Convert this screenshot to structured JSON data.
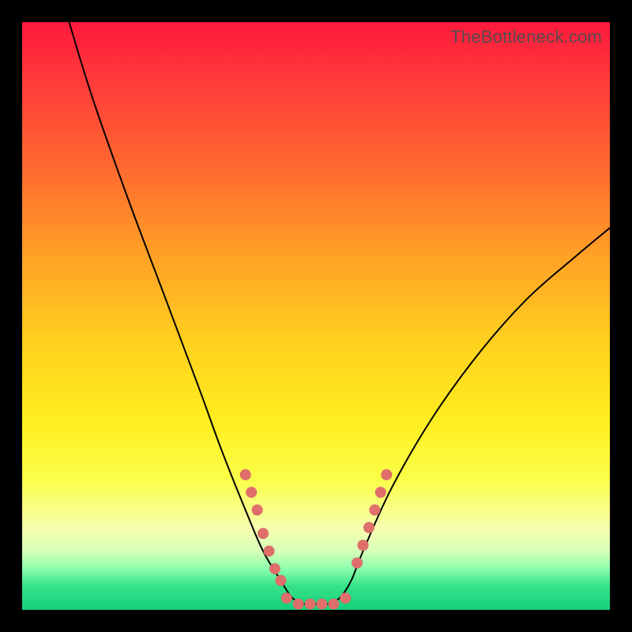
{
  "watermark": {
    "text": "TheBottleneck.com"
  },
  "colors": {
    "dot_fill": "#e06f6b",
    "curve_stroke": "#000000",
    "frame_bg_top": "#ff1a3c",
    "frame_bg_bottom": "#17d07a"
  },
  "chart_data": {
    "type": "line",
    "title": "",
    "xlabel": "",
    "ylabel": "",
    "xlim": [
      0,
      100
    ],
    "ylim": [
      0,
      100
    ],
    "grid": false,
    "legend": false,
    "note": "Bottleneck V-curve; y≈0 is optimal (green), y→100 is severe (red). Values estimated from pixel positions; no axes shown.",
    "series": [
      {
        "name": "bottleneck-curve",
        "x": [
          8,
          12,
          18,
          24,
          30,
          34,
          38,
          41,
          44,
          46,
          48,
          50,
          52,
          54,
          56,
          58,
          63,
          70,
          78,
          86,
          94,
          100
        ],
        "y": [
          100,
          87,
          70,
          54,
          38,
          27,
          17,
          10,
          5,
          2,
          1,
          1,
          1,
          2,
          5,
          10,
          21,
          33,
          44,
          53,
          60,
          65
        ]
      }
    ],
    "marker_clusters": [
      {
        "name": "left-slope-dots",
        "points": [
          {
            "x": 38,
            "y": 23
          },
          {
            "x": 39,
            "y": 20
          },
          {
            "x": 40,
            "y": 17
          },
          {
            "x": 41,
            "y": 13
          },
          {
            "x": 42,
            "y": 10
          },
          {
            "x": 43,
            "y": 7
          },
          {
            "x": 44,
            "y": 5
          }
        ]
      },
      {
        "name": "bottom-dots",
        "points": [
          {
            "x": 45,
            "y": 2
          },
          {
            "x": 47,
            "y": 1
          },
          {
            "x": 49,
            "y": 1
          },
          {
            "x": 51,
            "y": 1
          },
          {
            "x": 53,
            "y": 1
          },
          {
            "x": 55,
            "y": 2
          }
        ]
      },
      {
        "name": "right-slope-dots",
        "points": [
          {
            "x": 57,
            "y": 8
          },
          {
            "x": 58,
            "y": 11
          },
          {
            "x": 59,
            "y": 14
          },
          {
            "x": 60,
            "y": 17
          },
          {
            "x": 61,
            "y": 20
          },
          {
            "x": 62,
            "y": 23
          }
        ]
      }
    ]
  }
}
